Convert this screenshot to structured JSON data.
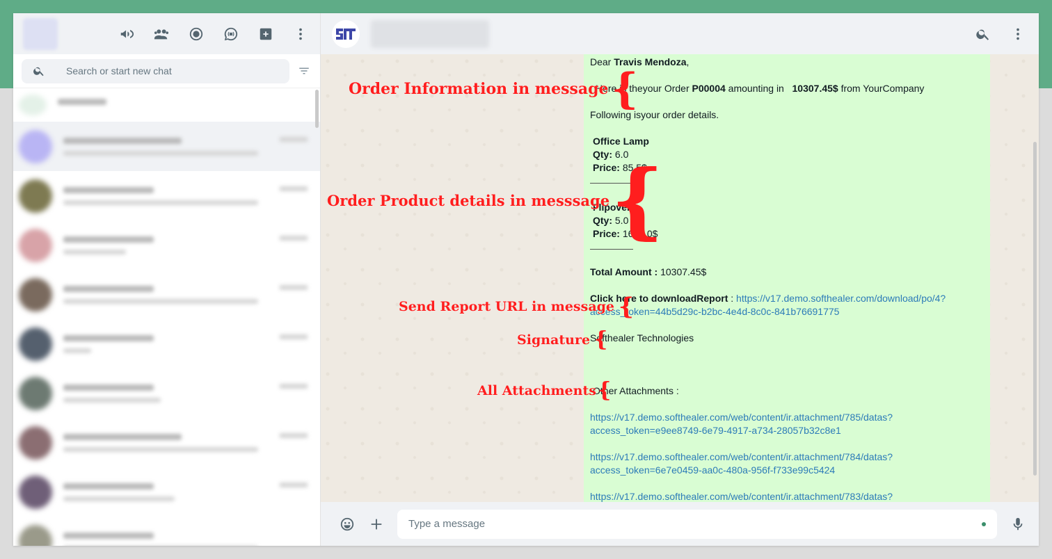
{
  "left": {
    "search_placeholder": "Search or start new chat"
  },
  "chat": {
    "greeting_prefix": "Dear",
    "customer_name": "Travis Mendoza",
    "greeting_suffix": ",",
    "order_line_1": "Here is theyour Order",
    "order_number": "P00004",
    "order_line_2": "amounting in",
    "order_amount": "10307.45$",
    "order_line_3": "from YourCompany",
    "details_intro": "Following isyour order details.",
    "products": [
      {
        "name": "Office Lamp",
        "qty_label": "Qty:",
        "qty": "6.0",
        "price_label": "Price:",
        "price": "85.5$"
      },
      {
        "name": "Flipover",
        "qty_label": "Qty:",
        "qty": "5.0",
        "price_label": "Price:",
        "price": "1690.0$"
      }
    ],
    "total_label": "Total Amount :",
    "total_value": "10307.45$",
    "report_label": "Click here to downloadReport",
    "report_colon": ":",
    "report_url_1": "https://v17.demo.softhealer.com/download/po/4?",
    "report_url_2": "access_token=44b5d29c-b2bc-4e4d-8c0c-841b76691775",
    "signature": "Softhealer Technologies",
    "attachments_label": "Other Attachments :",
    "attachments": [
      {
        "url_1": "https://v17.demo.softhealer.com/web/content/ir.attachment/785/datas?",
        "url_2": "access_token=e9ee8749-6e79-4917-a734-28057b32c8e1"
      },
      {
        "url_1": "https://v17.demo.softhealer.com/web/content/ir.attachment/784/datas?",
        "url_2": "access_token=6e7e0459-aa0c-480a-956f-f733e99c5424"
      },
      {
        "url_1": "https://v17.demo.softhealer.com/web/content/ir.attachment/783/datas?",
        "url_2": ""
      }
    ]
  },
  "annotations": {
    "order_info": "Order Information in message",
    "product_details": "Order Product details in messsage",
    "report_url": "Send Report URL in message",
    "signature": "Signature",
    "attachments": "All Attachments"
  },
  "footer": {
    "message_placeholder": "Type a message"
  },
  "colors": {
    "accent_band": "#5fac87",
    "bubble": "#d9fdd3",
    "annotation": "#ff1e1e",
    "link": "#2c7bb8"
  },
  "icons": [
    "megaphone-icon",
    "communities-icon",
    "status-icon",
    "channels-icon",
    "new-chat-icon",
    "menu-icon",
    "search-icon",
    "filter-icon",
    "emoji-icon",
    "plus-icon",
    "mic-icon",
    "brand-logo-icon"
  ]
}
